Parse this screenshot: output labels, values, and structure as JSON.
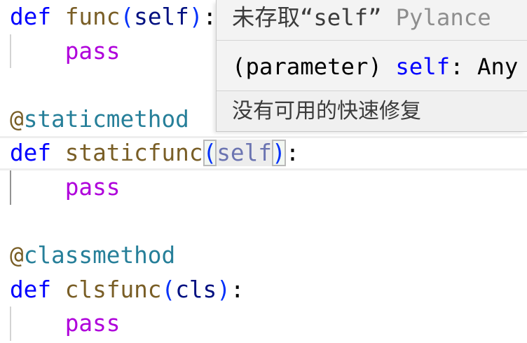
{
  "colors": {
    "editor-background": "#ffffff",
    "keyword": "#0000ff",
    "function": "#795e26",
    "bracket": "#0431fa",
    "parameter": "#001080",
    "control": "#af00db",
    "decorator": "#267f99",
    "decorator-at": "#795e26",
    "punctuation": "#000000",
    "self-builtin": "#0000ff",
    "current-line-border": "#eeeeee",
    "bracket-match-border": "#b9b9b9",
    "indent-guide": "#d3d3d3",
    "indent-guide-active": "#939393",
    "hover-background": "#f3f3f3",
    "hover-status-background": "#f0f0f0",
    "hover-border": "#c8c8c8",
    "hover-separator": "#d4d4d4",
    "hover-foreground": "#3b3b3b",
    "hover-muted": "#8e8e8e"
  },
  "editor": {
    "lines": [
      [
        "def",
        "func",
        "(",
        "self",
        ")",
        ":"
      ],
      [
        "pass"
      ],
      [],
      [
        "@",
        "staticmethod"
      ],
      [
        "def",
        "staticfunc",
        "(",
        "self",
        ")",
        ":"
      ],
      [
        "pass"
      ],
      [],
      [
        "@",
        "classmethod"
      ],
      [
        "def",
        "clsfunc",
        "(",
        "cls",
        ")",
        ":"
      ],
      [
        "pass"
      ]
    ]
  },
  "hover": {
    "diagnostic": {
      "message": "未存取“self”",
      "source": "Pylance"
    },
    "signature": {
      "kind": "(parameter)",
      "name": "self",
      "colon": ":",
      "type": "Any"
    },
    "status_bar": {
      "text": "没有可用的快速修复"
    }
  }
}
